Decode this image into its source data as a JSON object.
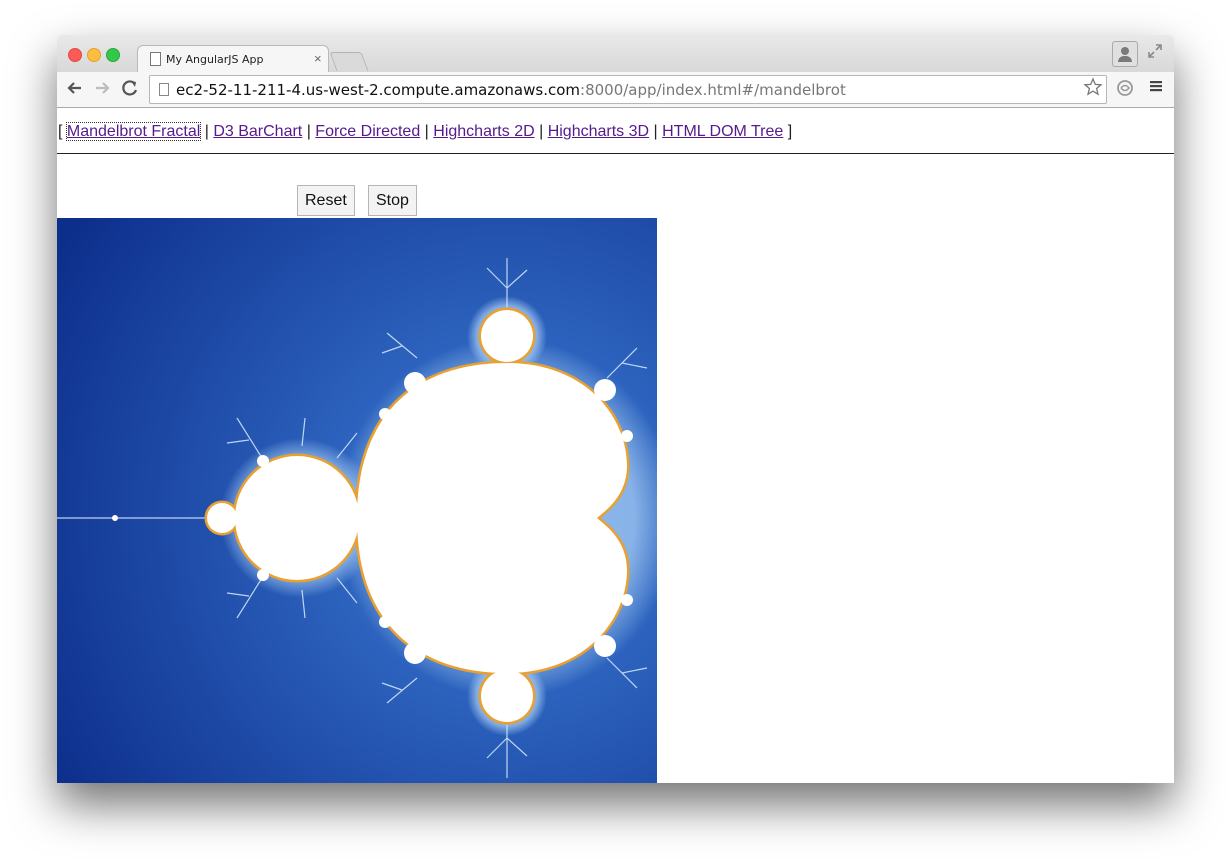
{
  "browser": {
    "tab_title": "My AngularJS App",
    "tab_close": "×",
    "url_host": "ec2-52-11-211-4.us-west-2.compute.amazonaws.com",
    "url_path": ":8000/app/index.html#/mandelbrot",
    "icons": {
      "back": "back-arrow-icon",
      "forward": "forward-arrow-icon",
      "reload": "reload-icon",
      "bookmark": "star-icon",
      "extension": "extension-icon",
      "menu": "hamburger-menu-icon",
      "profile": "profile-icon",
      "fullscreen": "fullscreen-icon"
    }
  },
  "nav": {
    "open_bracket": "[ ",
    "close_bracket": " ]",
    "separator": " | ",
    "links": [
      {
        "label": "Mandelbrot Fractal",
        "active": true
      },
      {
        "label": "D3 BarChart"
      },
      {
        "label": "Force Directed"
      },
      {
        "label": "Highcharts 2D"
      },
      {
        "label": "Highcharts 3D"
      },
      {
        "label": "HTML DOM Tree"
      }
    ]
  },
  "controls": {
    "reset_label": "Reset",
    "stop_label": "Stop"
  },
  "colors": {
    "fractal_bg_dark": "#0d2f8c",
    "fractal_bg_light": "#3a78cc",
    "fractal_set": "#ffffff",
    "fractal_edge": "#e8a030",
    "link": "#551a8b"
  }
}
